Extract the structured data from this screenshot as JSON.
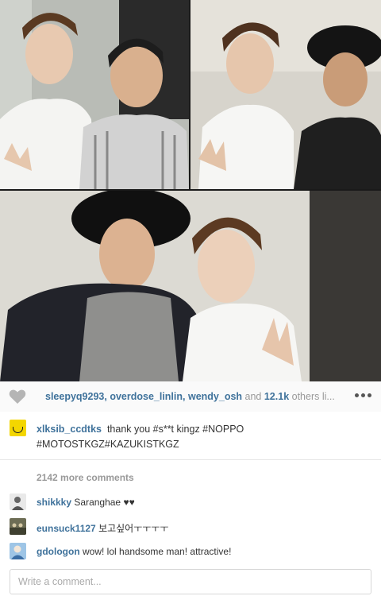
{
  "likes": {
    "users": [
      "sleepyq9293",
      "overdose_linlin",
      "wendy_osh"
    ],
    "separator": ", ",
    "and_text": " and ",
    "count": "12.1k",
    "others_text": " others li..."
  },
  "caption": {
    "username": "xlksib_ccdtks",
    "text": "thank you #s**t kingz #NOPPO #MOTOSTKGZ#KAZUKISTKGZ"
  },
  "more_comments": "2142 more comments",
  "comments": [
    {
      "username": "shikkky",
      "text": "Saranghae ♥♥"
    },
    {
      "username": "eunsuck1127",
      "text": "보고싶어ㅜㅜㅜㅜ"
    },
    {
      "username": "gdologon",
      "text": "wow! lol handsome man! attractive!"
    }
  ],
  "comment_input": {
    "placeholder": "Write a comment..."
  },
  "colors": {
    "link": "#3f729b",
    "caption_avatar": "#f3d600"
  },
  "icons": {
    "like": "heart-icon",
    "more": "ellipsis-icon"
  }
}
